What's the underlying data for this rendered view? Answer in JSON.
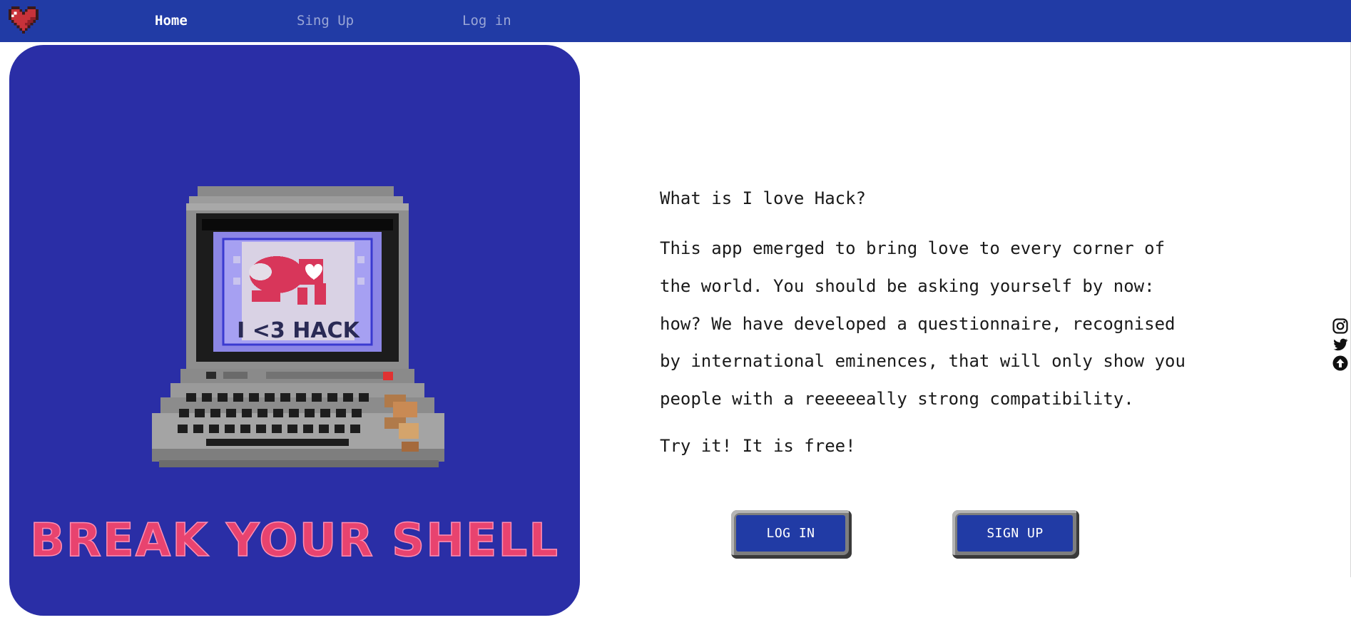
{
  "nav": {
    "logo_icon": "pixel-heart-icon",
    "links": [
      {
        "label": "Home",
        "active": true
      },
      {
        "label": "Sing Up",
        "active": false
      },
      {
        "label": "Log in",
        "active": false
      }
    ]
  },
  "hero": {
    "screen_text": "I <3 HACK",
    "banner": "BREAK YOUR SHELL"
  },
  "about": {
    "heading": "What is I love Hack?",
    "body": "This app emerged to bring love to every corner of the world. You should be asking yourself by now: how? We have developed a questionnaire, recognised by international eminences, that will only show you people with a reeeeeally strong compatibility.",
    "cta": "Try it! It is free!"
  },
  "buttons": {
    "login": "LOG IN",
    "signup": "SIGN UP"
  },
  "social": [
    "instagram-icon",
    "twitter-icon",
    "arrow-up-circle-icon"
  ],
  "colors": {
    "navbar": "#213ba5",
    "hero_background": "#2a2ea6",
    "banner_pink": "#e8436f",
    "button_face": "#213ba5"
  }
}
